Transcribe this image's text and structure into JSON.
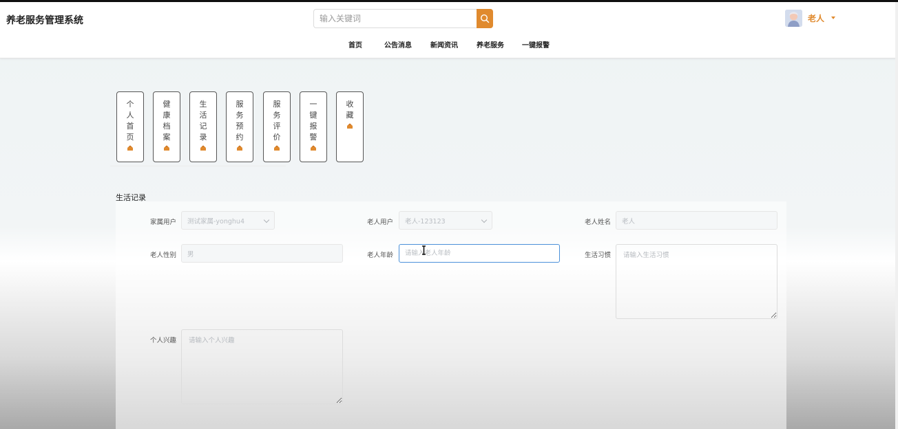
{
  "header": {
    "title": "养老服务管理系统",
    "search": {
      "placeholder": "输入关键词"
    },
    "user": {
      "name": "老人"
    },
    "nav": [
      "首页",
      "公告消息",
      "新闻资讯",
      "养老服务",
      "一键报警"
    ]
  },
  "side_tabs": [
    {
      "label": "个人首页"
    },
    {
      "label": "健康档案"
    },
    {
      "label": "生活记录"
    },
    {
      "label": "服务预约"
    },
    {
      "label": "服务评价"
    },
    {
      "label": "一键报警"
    },
    {
      "label": "收藏"
    }
  ],
  "section_title": "生活记录",
  "form": {
    "family_user": {
      "label": "家属用户",
      "value": "测试家属-yonghu4"
    },
    "elder_user": {
      "label": "老人用户",
      "value": "老人-123123"
    },
    "elder_name": {
      "label": "老人姓名",
      "value": "老人"
    },
    "elder_gender": {
      "label": "老人性别",
      "value": "男"
    },
    "elder_age": {
      "label": "老人年龄",
      "placeholder": "请输入老人年龄"
    },
    "habits": {
      "label": "生活习惯",
      "placeholder": "请输入生活习惯"
    },
    "interests": {
      "label": "个人兴趣",
      "placeholder": "请输入个人兴趣"
    }
  },
  "colors": {
    "accent": "#e08a2e",
    "focus": "#4a90d9"
  },
  "icons": {
    "search": "search-icon",
    "tab": "house-icon"
  }
}
